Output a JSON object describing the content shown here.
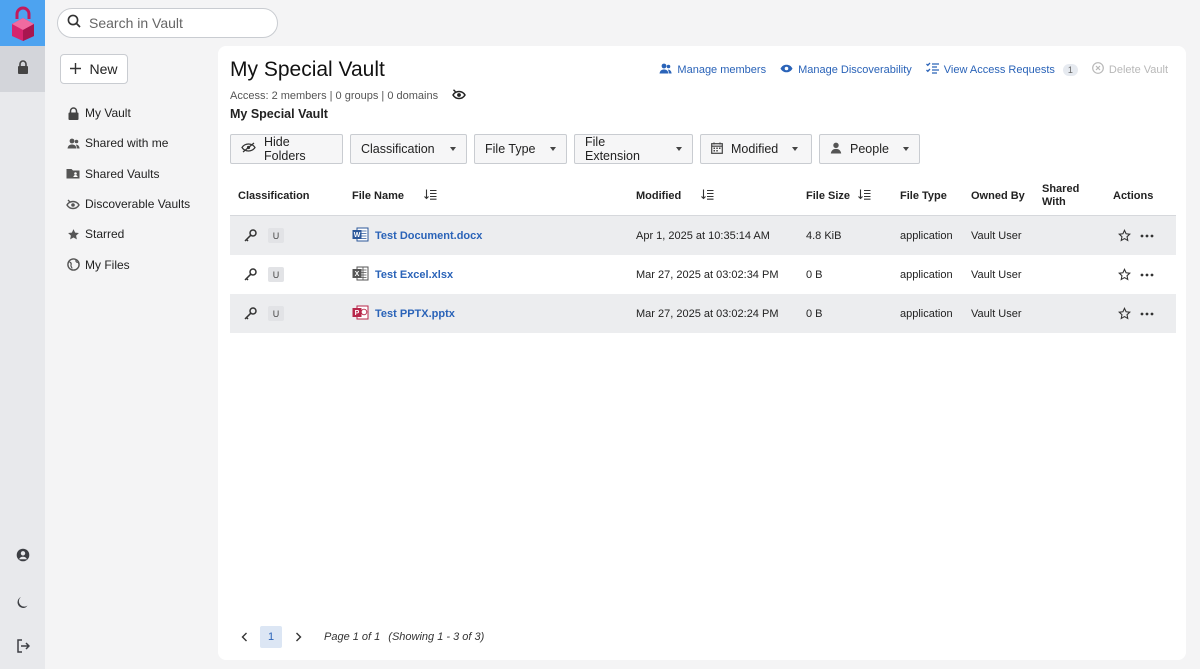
{
  "search": {
    "placeholder": "Search in Vault"
  },
  "new_button": {
    "label": "New"
  },
  "sidebar": {
    "items": [
      {
        "label": "My Vault",
        "icon": "lock-icon"
      },
      {
        "label": "Shared with me",
        "icon": "people-icon"
      },
      {
        "label": "Shared Vaults",
        "icon": "shared-folder-icon"
      },
      {
        "label": "Discoverable Vaults",
        "icon": "discover-eye-icon"
      },
      {
        "label": "Starred",
        "icon": "star-icon"
      },
      {
        "label": "My Files",
        "icon": "globe-icon"
      }
    ]
  },
  "vault": {
    "title": "My Special Vault",
    "access": "Access: 2 members | 0 groups | 0 domains",
    "subtitle": "My Special Vault"
  },
  "top_actions": {
    "manage_members": "Manage members",
    "manage_discoverability": "Manage Discoverability",
    "view_access_requests": "View Access Requests",
    "access_requests_count": "1",
    "delete_vault": "Delete Vault"
  },
  "filters": {
    "hide_folders": "Hide Folders",
    "classification": "Classification",
    "file_type": "File Type",
    "file_extension": "File Extension",
    "modified": "Modified",
    "people": "People"
  },
  "table": {
    "headers": {
      "classification": "Classification",
      "file_name": "File Name",
      "modified": "Modified",
      "file_size": "File Size",
      "file_type": "File Type",
      "owned_by": "Owned By",
      "shared_with": "Shared With",
      "actions": "Actions"
    },
    "rows": [
      {
        "classification": "U",
        "file_name": "Test Document.docx",
        "file_icon": "word-icon",
        "icon_color": "#2b579a",
        "icon_letter": "W",
        "modified": "Apr 1, 2025 at 10:35:14 AM",
        "size": "4.8 KiB",
        "type": "application",
        "owner": "Vault User"
      },
      {
        "classification": "U",
        "file_name": "Test Excel.xlsx",
        "file_icon": "excel-icon",
        "icon_color": "#555555",
        "icon_letter": "X",
        "modified": "Mar 27, 2025 at 03:02:34 PM",
        "size": "0 B",
        "type": "application",
        "owner": "Vault User"
      },
      {
        "classification": "U",
        "file_name": "Test PPTX.pptx",
        "file_icon": "powerpoint-icon",
        "icon_color": "#b7274a",
        "icon_letter": "P",
        "modified": "Mar 27, 2025 at 03:02:24 PM",
        "size": "0 B",
        "type": "application",
        "owner": "Vault User"
      }
    ]
  },
  "pagination": {
    "current": "1",
    "page_info": "Page 1 of 1",
    "showing": "(Showing 1 - 3 of 3)"
  },
  "colors": {
    "accent": "#2a63b8",
    "rail_highlight": "#4da3f0",
    "logo": "#d6246e"
  }
}
